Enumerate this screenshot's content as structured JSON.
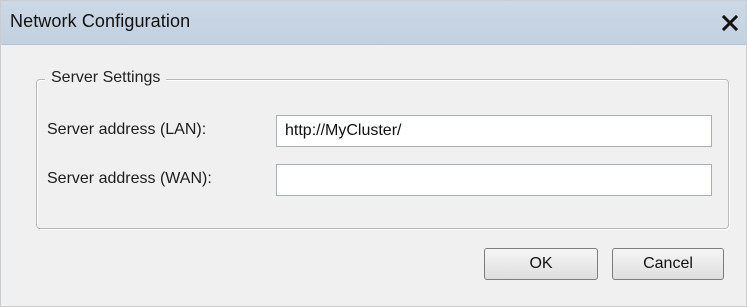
{
  "window": {
    "title": "Network Configuration",
    "close_icon": "close-x-icon"
  },
  "server_settings": {
    "group_label": "Server Settings",
    "lan_label": "Server address (LAN):",
    "lan_value": "http://MyCluster/",
    "wan_label": "Server address (WAN):",
    "wan_value": ""
  },
  "buttons": {
    "ok_label": "OK",
    "cancel_label": "Cancel"
  }
}
